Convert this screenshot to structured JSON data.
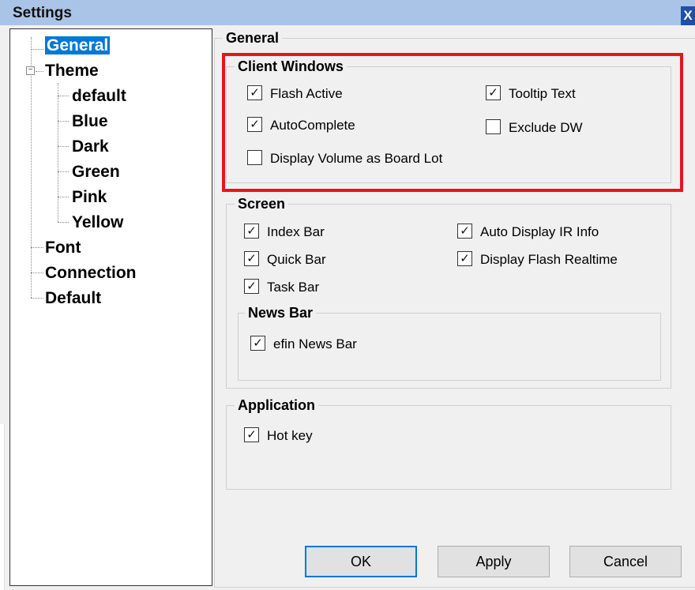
{
  "window": {
    "title": "Settings",
    "close_glyph": "X"
  },
  "tree": {
    "items": [
      {
        "label": "General",
        "selected": true
      },
      {
        "label": "Theme",
        "expanded": true
      },
      {
        "label": "default"
      },
      {
        "label": "Blue"
      },
      {
        "label": "Dark"
      },
      {
        "label": "Green"
      },
      {
        "label": "Pink"
      },
      {
        "label": "Yellow"
      },
      {
        "label": "Font"
      },
      {
        "label": "Connection"
      },
      {
        "label": "Default"
      }
    ],
    "expander_glyph": "−"
  },
  "general": {
    "title": "General",
    "client_windows": {
      "title": "Client Windows",
      "flash_active": {
        "label": "Flash Active",
        "checked": true
      },
      "tooltip_text": {
        "label": "Tooltip Text",
        "checked": true
      },
      "autocomplete": {
        "label": "AutoComplete",
        "checked": true
      },
      "exclude_dw": {
        "label": "Exclude DW",
        "checked": false
      },
      "display_volume": {
        "label": "Display Volume as Board Lot",
        "checked": false
      }
    },
    "screen": {
      "title": "Screen",
      "index_bar": {
        "label": "Index Bar",
        "checked": true
      },
      "auto_display_ir": {
        "label": "Auto Display IR Info",
        "checked": true
      },
      "quick_bar": {
        "label": "Quick Bar",
        "checked": true
      },
      "display_flash_realtime": {
        "label": "Display Flash Realtime",
        "checked": true
      },
      "task_bar": {
        "label": "Task Bar",
        "checked": true
      },
      "news_bar": {
        "title": "News Bar",
        "efin_news_bar": {
          "label": "efin News Bar",
          "checked": true
        }
      }
    },
    "application": {
      "title": "Application",
      "hot_key": {
        "label": "Hot key",
        "checked": true
      }
    }
  },
  "buttons": {
    "ok": "OK",
    "apply": "Apply",
    "cancel": "Cancel"
  },
  "colors": {
    "selection": "#0078d7",
    "highlight_border": "#e8141c",
    "titlebar": "#a9c4e6"
  }
}
